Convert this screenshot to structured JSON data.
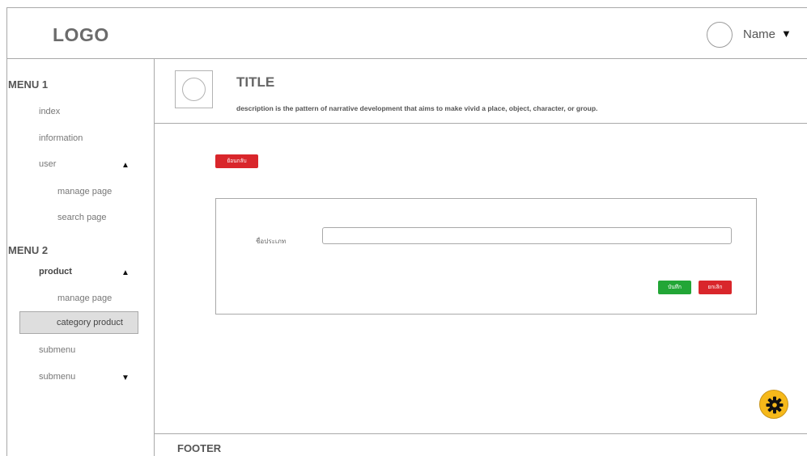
{
  "header": {
    "logo": "LOGO",
    "user_name": "Name",
    "user_caret": "▼"
  },
  "sidebar": {
    "menu1": {
      "title": "MENU 1",
      "items": [
        "index",
        "information",
        "user",
        "manage page",
        "search page"
      ],
      "user_caret": "▲"
    },
    "menu2": {
      "title": "MENU 2",
      "product": "product",
      "product_caret": "▲",
      "manage": "manage page",
      "category": "category product",
      "submenu1": "submenu",
      "submenu2": "submenu",
      "submenu2_caret": "▼"
    }
  },
  "page": {
    "title": "TITLE",
    "description": "description is the pattern of narrative development that aims to make vivid a place, object, character, or group."
  },
  "content": {
    "back_button": "ย้อนกลับ",
    "field_label": "ชื่อประเภท",
    "field_value": "",
    "save_button": "บันทึก",
    "cancel_button": "ยกเลิก"
  },
  "footer": {
    "text": "FOOTER"
  },
  "icons": {
    "settings": "gear-icon"
  },
  "colors": {
    "danger": "#d9262b",
    "success": "#22a636",
    "gear": "#f6b91a",
    "selected_bg": "#dedede"
  }
}
